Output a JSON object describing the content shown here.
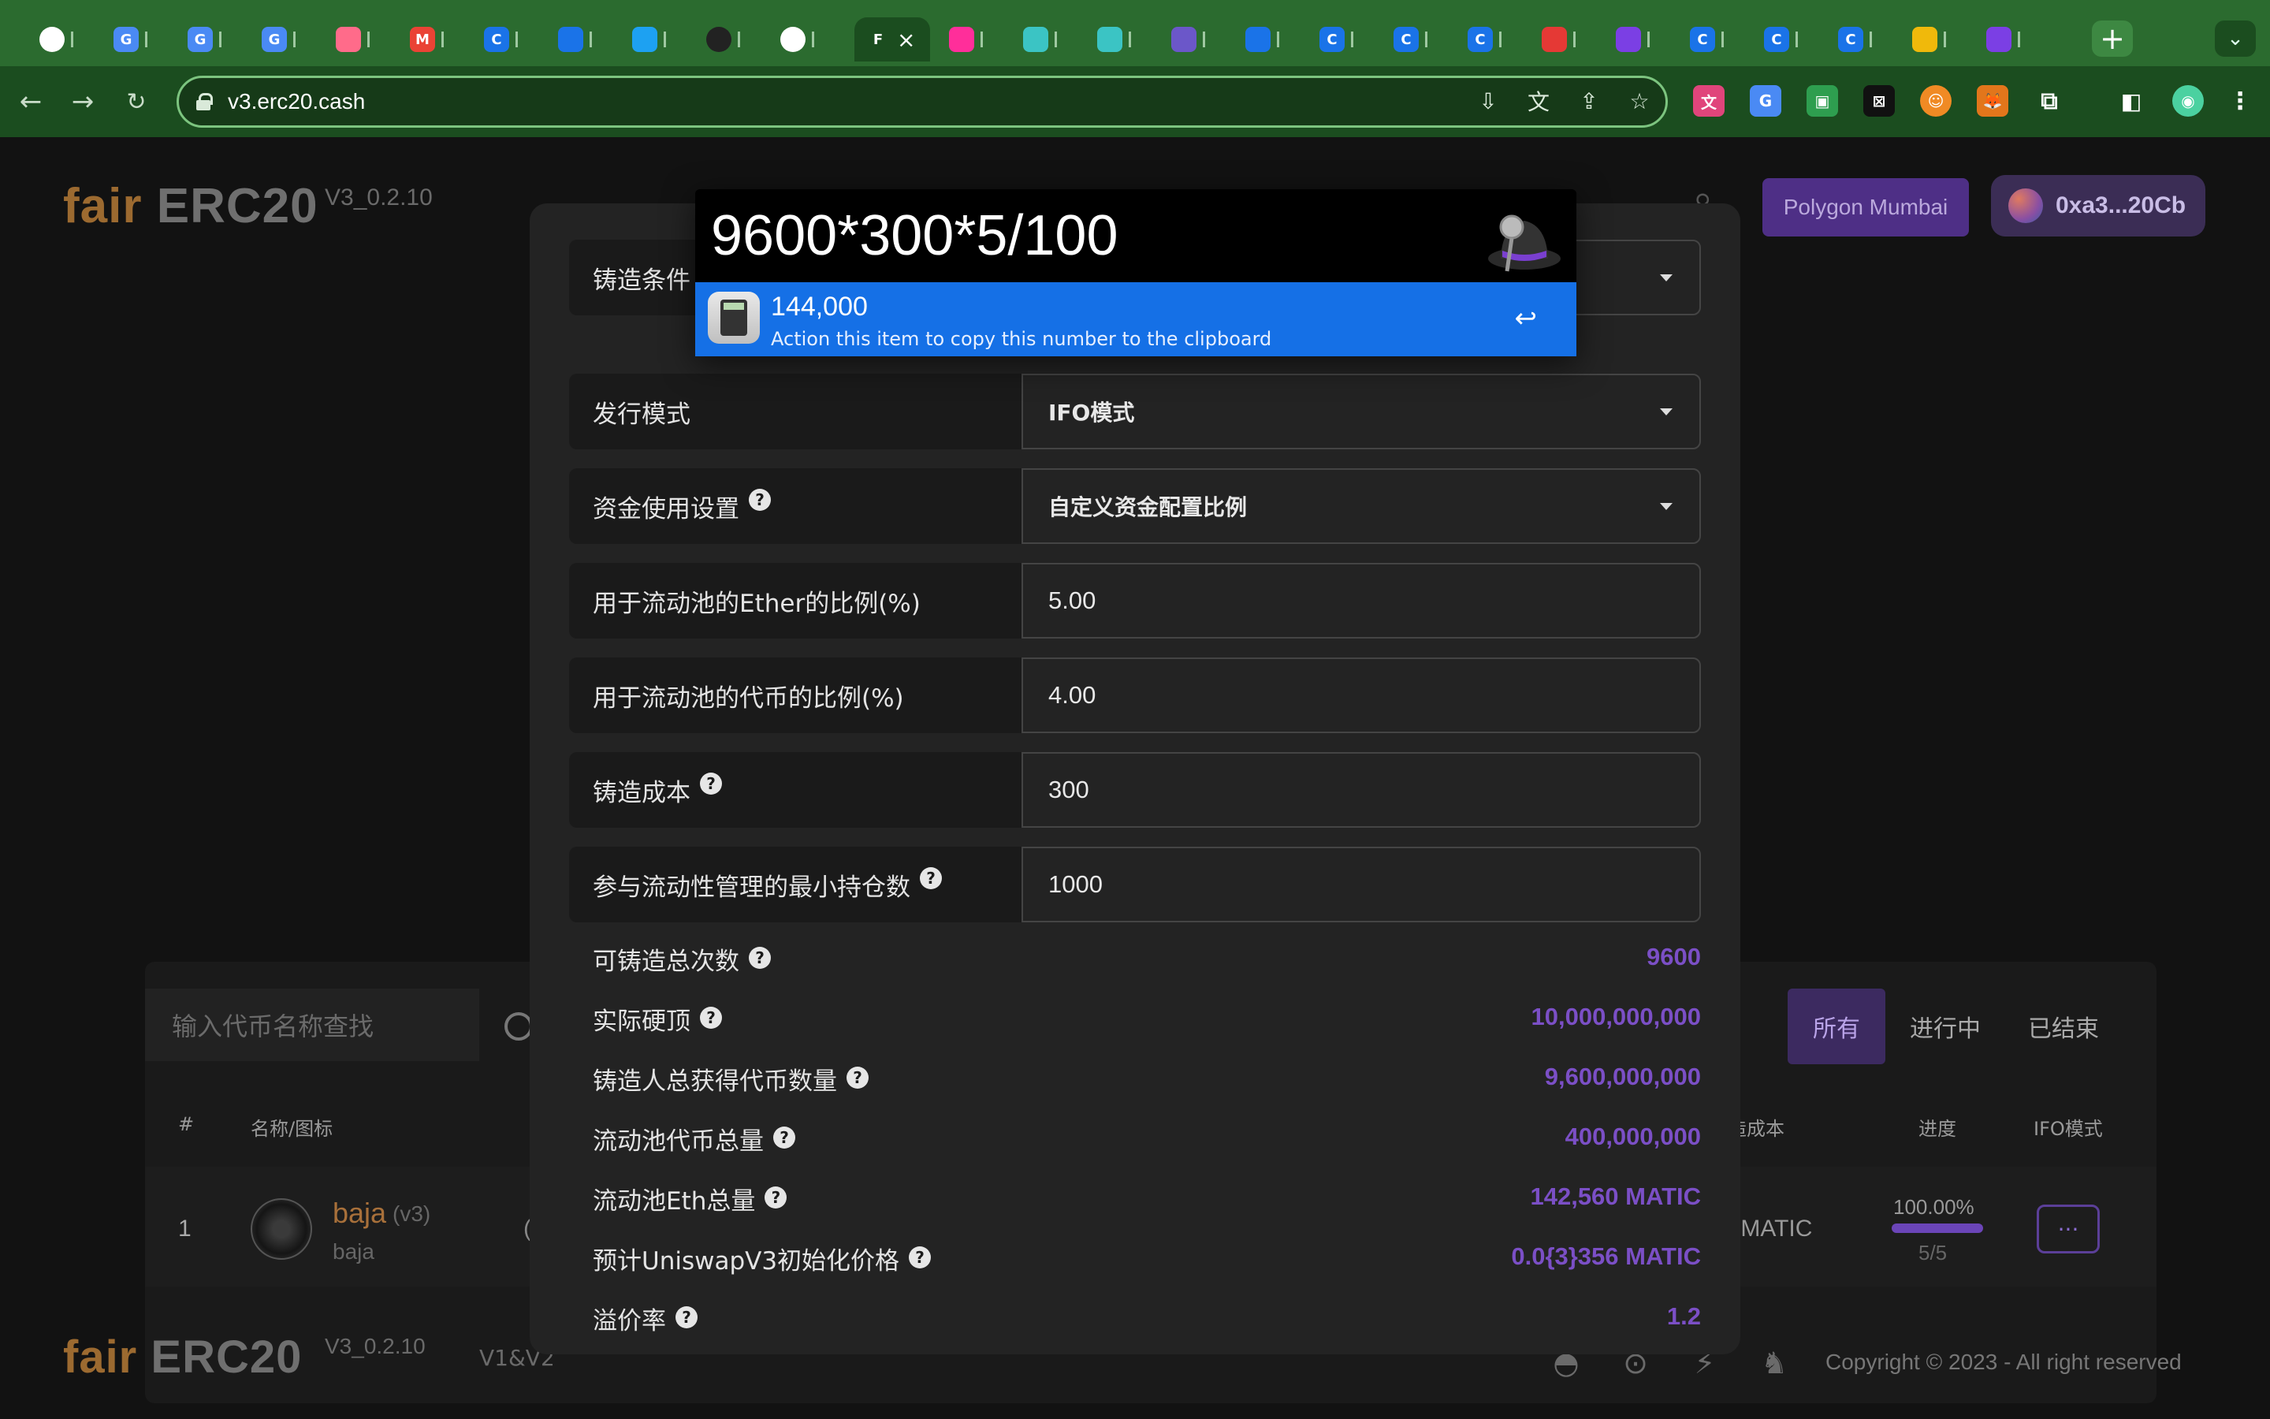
{
  "browser": {
    "tabs": [
      {
        "icon": "generic-icon",
        "letter": "",
        "color": "#ffffff",
        "suffix": "I"
      },
      {
        "icon": "google-translate-icon",
        "letter": "G",
        "color": "#4a8af4",
        "suffix": "("
      },
      {
        "icon": "google-translate-icon",
        "letter": "G",
        "color": "#4a8af4",
        "suffix": "("
      },
      {
        "icon": "google-translate-icon",
        "letter": "G",
        "color": "#4a8af4",
        "suffix": "("
      },
      {
        "icon": "pink-circle-icon",
        "letter": "",
        "color": "#ff6b8a",
        "suffix": "."
      },
      {
        "icon": "gmail-icon",
        "letter": "M",
        "color": "#ea4335",
        "suffix": "I"
      },
      {
        "icon": "blue-c-icon",
        "letter": "C",
        "color": "#1a73e8",
        "suffix": "I"
      },
      {
        "icon": "blue-shield-icon",
        "letter": "",
        "color": "#1a73e8",
        "suffix": "I"
      },
      {
        "icon": "twitter-icon",
        "letter": "",
        "color": "#1da1f2",
        "suffix": "I"
      },
      {
        "icon": "github-icon",
        "letter": "",
        "color": "#222222",
        "suffix": ":"
      },
      {
        "icon": "globe-icon",
        "letter": "",
        "color": "#ffffff",
        "suffix": "I"
      },
      {
        "icon": "active-tab",
        "letter": "F",
        "color": "#1b4d1f",
        "suffix": ""
      },
      {
        "icon": "pink-figure-icon",
        "letter": "",
        "color": "#ff2e9a",
        "suffix": "I"
      },
      {
        "icon": "cube-icon",
        "letter": "",
        "color": "#3bc4c4",
        "suffix": "I"
      },
      {
        "icon": "cube-icon",
        "letter": "",
        "color": "#3bc4c4",
        "suffix": "I"
      },
      {
        "icon": "purple-circle-icon",
        "letter": "",
        "color": "#6b57c9",
        "suffix": "."
      },
      {
        "icon": "triangle-icon",
        "letter": "",
        "color": "#1a73e8",
        "suffix": "I"
      },
      {
        "icon": "blue-c-icon",
        "letter": "C",
        "color": "#1a73e8",
        "suffix": "("
      },
      {
        "icon": "blue-c-icon",
        "letter": "C",
        "color": "#1a73e8",
        "suffix": "I"
      },
      {
        "icon": "blue-c-icon",
        "letter": "C",
        "color": "#1a73e8",
        "suffix": "I"
      },
      {
        "icon": "red-logo-icon",
        "letter": "",
        "color": "#e53935",
        "suffix": ":"
      },
      {
        "icon": "list-icon",
        "letter": "",
        "color": "#7b3fe4",
        "suffix": ":"
      },
      {
        "icon": "blue-c-icon",
        "letter": "C",
        "color": "#1a73e8",
        "suffix": ":"
      },
      {
        "icon": "blue-c-icon",
        "letter": "C",
        "color": "#1a73e8",
        "suffix": "I"
      },
      {
        "icon": "blue-c-icon",
        "letter": "C",
        "color": "#1a73e8",
        "suffix": "I"
      },
      {
        "icon": "binance-icon",
        "letter": "",
        "color": "#f0b90b",
        "suffix": "I"
      },
      {
        "icon": "list-icon",
        "letter": "",
        "color": "#7b3fe4",
        "suffix": "I"
      }
    ],
    "active_tab_letter": "F",
    "url": "v3.erc20.cash"
  },
  "site": {
    "logo_fair": "fair",
    "logo_erc": "ERC20",
    "version": "V3_0.2.10",
    "network_button": "Polygon Mumbai",
    "wallet_button": "0xa3...20Cb",
    "footer_links": "V1&V2",
    "copyright": "Copyright © 2023 - All right reserved"
  },
  "list": {
    "search_placeholder": "输入代币名称查找",
    "filters": [
      "所有",
      "进行中",
      "已结束"
    ],
    "headers": {
      "index": "#",
      "name": "名称/图标",
      "cost": "造成本",
      "progress": "进度",
      "mode": "IFO模式"
    },
    "row": {
      "index": "1",
      "name": "baja",
      "tag": "(v3)",
      "symbol": "baja",
      "col3_fragment": "(",
      "cost": ") MATIC",
      "progress_percent": "100.00%",
      "progress_count": "5/5",
      "progress_fraction": 1.0,
      "action": "···"
    }
  },
  "modal": {
    "mint_condition_label": "铸造条件",
    "fields": [
      {
        "label": "发行模式",
        "value": "IFO模式",
        "type": "select",
        "help": false
      },
      {
        "label": "资金使用设置",
        "value": "自定义资金配置比例",
        "type": "select",
        "help": true
      },
      {
        "label": "用于流动池的Ether的比例(%)",
        "value": "5.00",
        "type": "input",
        "help": false
      },
      {
        "label": "用于流动池的代币的比例(%)",
        "value": "4.00",
        "type": "input",
        "help": false
      },
      {
        "label": "铸造成本",
        "value": "300",
        "type": "input",
        "help": true
      },
      {
        "label": "参与流动性管理的最小持仓数",
        "value": "1000",
        "type": "input",
        "help": true
      }
    ],
    "stats": [
      {
        "label": "可铸造总次数",
        "value": "9600"
      },
      {
        "label": "实际硬顶",
        "value": "10,000,000,000"
      },
      {
        "label": "铸造人总获得代币数量",
        "value": "9,600,000,000"
      },
      {
        "label": "流动池代币总量",
        "value": "400,000,000"
      },
      {
        "label": "流动池Eth总量",
        "value": "142,560 MATIC"
      },
      {
        "label": "预计UniswapV3初始化价格",
        "value": "0.0{3}356 MATIC"
      },
      {
        "label": "溢价率",
        "value": "1.2"
      }
    ]
  },
  "alfred": {
    "query": "9600*300*5/100",
    "result_title": "144,000",
    "result_subtitle": "Action this item to copy this number to the clipboard",
    "enter_symbol": "↩"
  }
}
